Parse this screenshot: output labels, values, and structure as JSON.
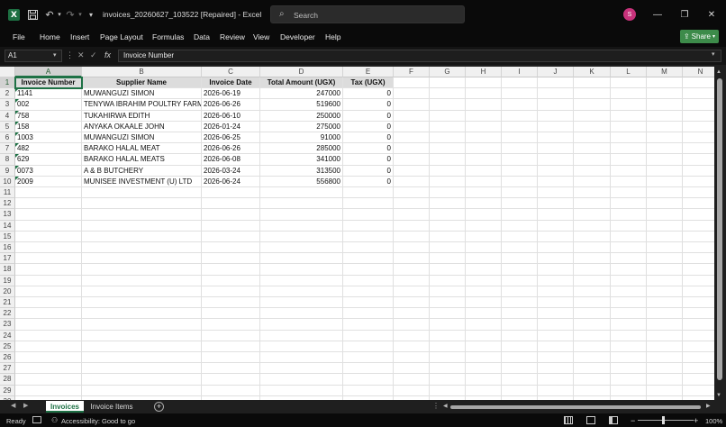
{
  "window": {
    "app_icon": "X",
    "title": "invoices_20260627_103522 [Repaired]  -  Excel",
    "search_placeholder": "Search",
    "avatar_initial": "S",
    "minimize": "—",
    "restore": "❐",
    "close": "✕",
    "save_icon": "💾",
    "undo_icon": "↶",
    "redo_icon": "↷",
    "dropdown_icon": "▾"
  },
  "menu": [
    "File",
    "Home",
    "Insert",
    "Page Layout",
    "Formulas",
    "Data",
    "Review",
    "View",
    "Developer",
    "Help"
  ],
  "share_label": "Share",
  "formula_bar": {
    "name_box": "A1",
    "formula": "Invoice Number",
    "cancel_sym": "✕",
    "enter_sym": "✓",
    "fx_sym": "fx"
  },
  "columns": [
    "A",
    "B",
    "C",
    "D",
    "E",
    "F",
    "G",
    "H",
    "I",
    "J",
    "K",
    "L",
    "M",
    "N"
  ],
  "rows": [
    "1",
    "2",
    "3",
    "4",
    "5",
    "6",
    "7",
    "8",
    "9",
    "10",
    "11",
    "12",
    "13",
    "14",
    "15",
    "16",
    "17",
    "18",
    "19",
    "20",
    "21",
    "22",
    "23",
    "24",
    "25",
    "26",
    "27",
    "28",
    "29",
    "30"
  ],
  "table": {
    "headers": [
      "Invoice Number",
      "Supplier Name",
      "Invoice Date",
      "Total Amount (UGX)",
      "Tax (UGX)"
    ],
    "data": [
      [
        "1141",
        "MUWANGUZI SIMON",
        "2026-06-19",
        "247000",
        "0"
      ],
      [
        "002",
        "TENYWA IBRAHIM POULTRY FARM",
        "2026-06-26",
        "519600",
        "0"
      ],
      [
        "758",
        "TUKAHIRWA EDITH",
        "2026-06-10",
        "250000",
        "0"
      ],
      [
        "158",
        "ANYAKA OKAALE JOHN",
        "2026-01-24",
        "275000",
        "0"
      ],
      [
        "1003",
        "MUWANGUZI SIMON",
        "2026-06-25",
        "91000",
        "0"
      ],
      [
        "482",
        "BARAKO HALAL MEAT",
        "2026-06-26",
        "285000",
        "0"
      ],
      [
        "629",
        "BARAKO HALAL MEATS",
        "2026-06-08",
        "341000",
        "0"
      ],
      [
        "0073",
        "A & B BUTCHERY",
        "2026-03-24",
        "313500",
        "0"
      ],
      [
        "2009",
        "MUNISEE INVESTMENT (U) LTD",
        "2026-06-24",
        "556800",
        "0"
      ]
    ]
  },
  "sheets": [
    "Invoices",
    "Invoice Items"
  ],
  "status": {
    "ready": "Ready",
    "accessibility": "Accessibility: Good to go",
    "zoom": "100%",
    "zoom_minus": "−",
    "zoom_plus": "+"
  }
}
